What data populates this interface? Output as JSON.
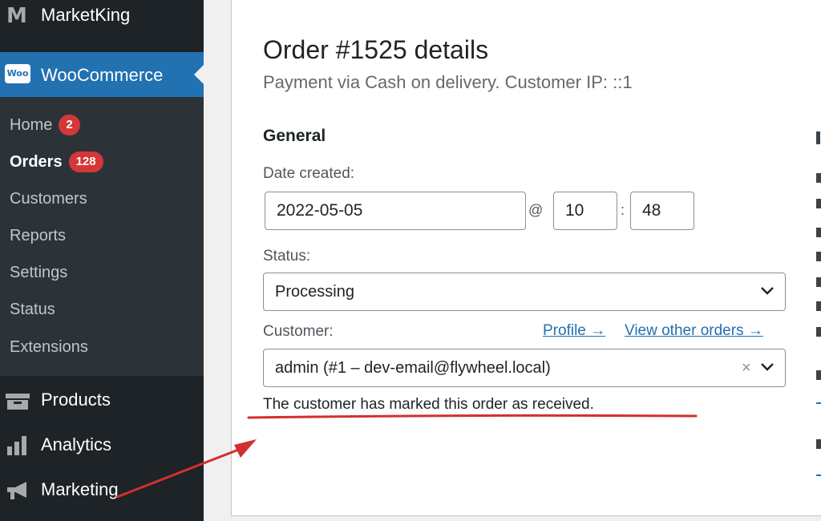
{
  "sidebar": {
    "brand": {
      "logo_text": "M",
      "label": "MarketKing"
    },
    "woo": {
      "logo_text": "Woo",
      "label": "WooCommerce"
    },
    "submenu": [
      {
        "label": "Home",
        "badge": "2"
      },
      {
        "label": "Orders",
        "badge": "128"
      },
      {
        "label": "Customers"
      },
      {
        "label": "Reports"
      },
      {
        "label": "Settings"
      },
      {
        "label": "Status"
      },
      {
        "label": "Extensions"
      }
    ],
    "menu": [
      {
        "label": "Products",
        "icon": "archive-icon"
      },
      {
        "label": "Analytics",
        "icon": "bar-chart-icon"
      },
      {
        "label": "Marketing",
        "icon": "megaphone-icon"
      }
    ]
  },
  "order": {
    "title": "Order #1525 details",
    "subtitle": "Payment via Cash on delivery. Customer IP: ::1",
    "general_heading": "General",
    "date_label": "Date created:",
    "date_value": "2022-05-05",
    "at_sign": "@",
    "hour_value": "10",
    "time_sep": ":",
    "minute_value": "48",
    "status_label": "Status:",
    "status_value": "Processing",
    "customer_label": "Customer:",
    "profile_link": "Profile →",
    "view_orders_link": "View other orders →",
    "customer_value": "admin (#1 – dev-email@flywheel.local)",
    "clear_symbol": "×",
    "received_note": "The customer has marked this order as received."
  },
  "colors": {
    "sidebar_bg": "#1d2327",
    "submenu_bg": "#2c3338",
    "accent": "#2271b1",
    "badge": "#d63638",
    "annotation": "#d32f2f"
  }
}
